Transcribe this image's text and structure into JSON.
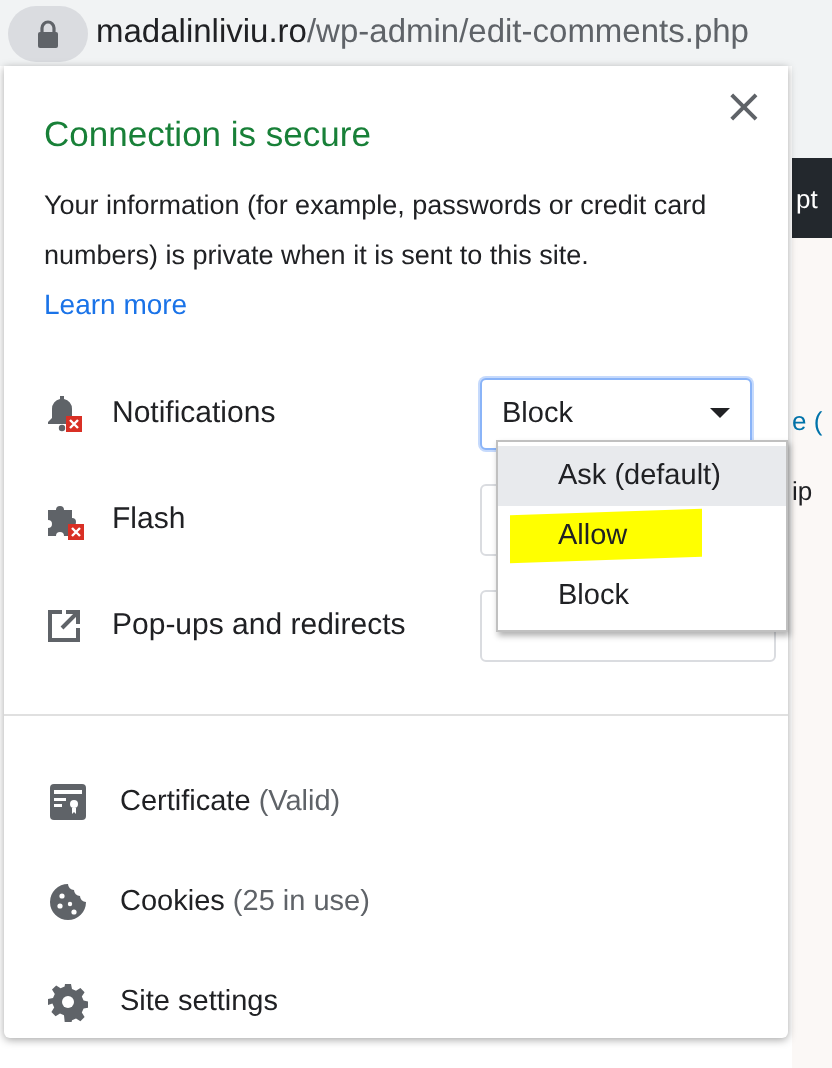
{
  "address_bar": {
    "domain": "madalinliviu.ro",
    "path": "/wp-admin/edit-comments.php"
  },
  "background_page": {
    "fragments": [
      "pt",
      "e (",
      "ip"
    ]
  },
  "popup": {
    "title": "Connection is secure",
    "description": "Your information (for example, passwords or credit card numbers) is private when it is sent to this site.",
    "link": "Learn more",
    "close": "×",
    "permissions": [
      {
        "kind": "notifications",
        "label": "Notifications",
        "value": "Block",
        "open": true
      },
      {
        "kind": "flash",
        "label": "Flash",
        "open": false
      },
      {
        "kind": "popups",
        "label": "Pop-ups and redirects",
        "open": false
      }
    ],
    "dropdown_options": [
      {
        "label": "Ask (default)",
        "hovered": true,
        "marked": false
      },
      {
        "label": "Allow",
        "hovered": false,
        "marked": true
      },
      {
        "label": "Block",
        "hovered": false,
        "marked": false
      }
    ],
    "links": [
      {
        "kind": "certificate",
        "label": "Certificate",
        "detail": "(Valid)"
      },
      {
        "kind": "cookies",
        "label": "Cookies",
        "detail": "(25 in use)"
      },
      {
        "kind": "settings",
        "label": "Site settings"
      }
    ]
  }
}
